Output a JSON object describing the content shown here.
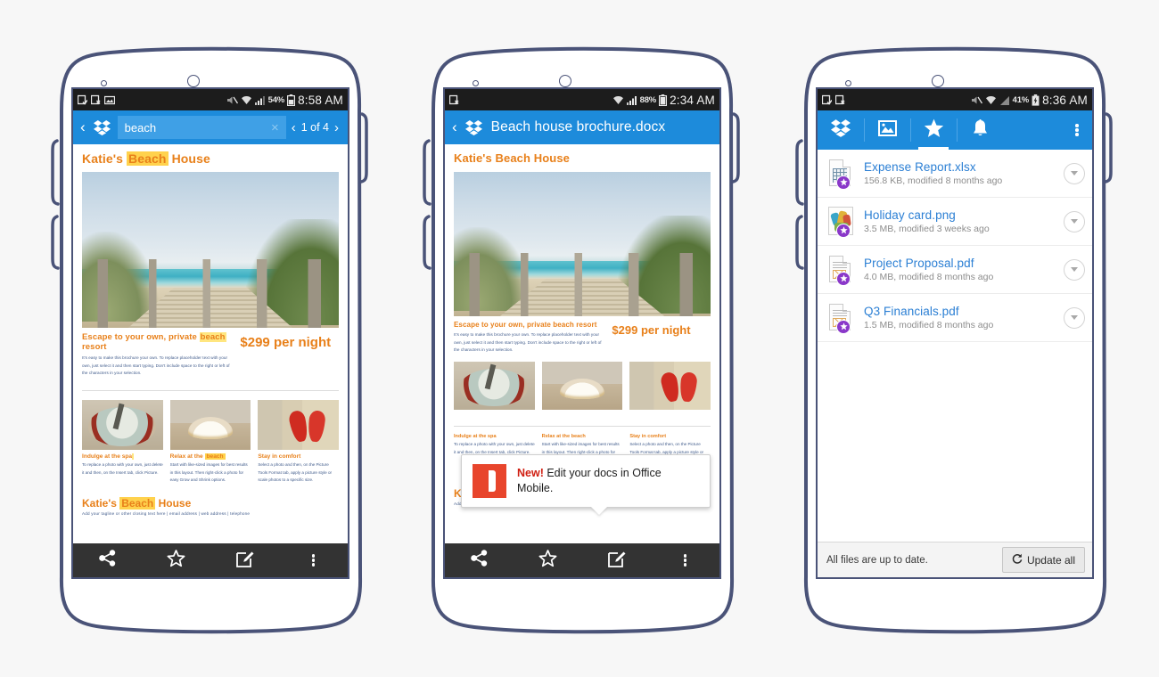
{
  "phones": [
    {
      "id": "phone-search-result",
      "statusbar": {
        "battery_pct": "54%",
        "time": "8:58 AM",
        "icons": [
          "download-complete-icon",
          "download-failed-icon",
          "screenshot-icon",
          "mute-icon",
          "wifi-icon",
          "signal-icon",
          "battery-icon"
        ]
      },
      "appbar": {
        "back_label": "‹",
        "logo": "dropbox-logo-icon",
        "search_value": "beach",
        "search_placeholder": "Search",
        "clear_label": "×",
        "prev_label": "‹",
        "pager_label": "1 of 4",
        "next_label": "›"
      },
      "document": {
        "title_pre": "Katie's ",
        "title_hl": "Beach",
        "title_post": " House",
        "sub_pre": "Escape to your own, private ",
        "sub_hl": "beach",
        "sub_post": " resort",
        "body": "It's easy to make this brochure your own. To replace placeholder text with your own, just select it and then start typing. Don't include space to the right or left of the characters in your selection.",
        "price": "$299 per night",
        "cards": [
          {
            "heading_pre": "Indulge at the spa",
            "heading_hl": "",
            "heading_post": "",
            "body": "To replace a photo with your own, just delete it and then, on the Insert tab, click Picture.",
            "image": "spa-bowl-photo"
          },
          {
            "heading_pre": "Relax at the ",
            "heading_hl": "beach",
            "heading_post": "",
            "body": "Start with like-sized images for best results in this layout. Then right-click a photo for easy Grow and Shrink options.",
            "image": "seashell-photo"
          },
          {
            "heading_pre": "Stay in comfort",
            "heading_hl": "",
            "heading_post": "",
            "body": "Select a photo and then, on the Picture Tools Format tab, apply a picture style or scale photos to a specific size.",
            "image": "flip-flops-photo"
          }
        ],
        "footer_pre": "Katie's ",
        "footer_hl": "Beach",
        "footer_post": " House",
        "footer_sub": "Add your tagline or other closing text here  |  email address  |  web address  |  telephone"
      },
      "bottombar": [
        "share-icon",
        "star-icon",
        "edit-icon",
        "overflow-menu-icon"
      ]
    },
    {
      "id": "phone-document-preview",
      "statusbar": {
        "battery_pct": "88%",
        "time": "2:34 AM",
        "icons": [
          "download-failed-icon",
          "wifi-icon",
          "signal-icon",
          "battery-icon"
        ]
      },
      "appbar": {
        "back_label": "‹",
        "logo": "dropbox-logo-icon",
        "doc_title": "Beach house brochure.docx"
      },
      "document": {
        "title_pre": "Katie's Beach House",
        "title_hl": "",
        "title_post": "",
        "sub_pre": "Escape to your own, private beach resort",
        "sub_hl": "",
        "sub_post": "",
        "body": "It's easy to make this brochure your own. To replace placeholder text with your own, just select it and then start typing. Don't include space to the right or left of the characters in your selection.",
        "price": "$299 per night",
        "cards": [
          {
            "heading_pre": "Indulge at the spa",
            "heading_hl": "",
            "heading_post": "",
            "body": "To replace a photo with your own, just delete it and then, on the Insert tab, click Picture.",
            "image": "spa-bowl-photo"
          },
          {
            "heading_pre": "Relax at the beach",
            "heading_hl": "",
            "heading_post": "",
            "body": "Start with like-sized images for best results in this layout. Then right-click a photo for easy Grow and Shrink options.",
            "image": "seashell-photo"
          },
          {
            "heading_pre": "Stay in comfort",
            "heading_hl": "",
            "heading_post": "",
            "body": "Select a photo and then, on the Picture Tools Format tab, apply a picture style or scale photos to a specific size.",
            "image": "flip-flops-photo"
          }
        ],
        "footer_pre": "Katie's Beach House",
        "footer_hl": "",
        "footer_post": "",
        "footer_sub": "Add your tagline or other closing text here  |  email address  |  web address  |  telephone"
      },
      "tooltip": {
        "icon": "office-logo-icon",
        "badge": "New!",
        "message": " Edit your docs in Office Mobile."
      },
      "bottombar": [
        "share-icon",
        "star-icon",
        "edit-icon",
        "overflow-menu-icon"
      ]
    },
    {
      "id": "phone-favorites-list",
      "statusbar": {
        "battery_pct": "41%",
        "time": "8:36 AM",
        "icons": [
          "download-complete-icon",
          "download-failed-icon",
          "mute-icon",
          "wifi-icon",
          "signal-icon",
          "battery-charging-icon"
        ]
      },
      "tabs": [
        {
          "name": "tab-files",
          "icon": "dropbox-logo-icon",
          "active": false
        },
        {
          "name": "tab-photos",
          "icon": "photos-icon",
          "active": false
        },
        {
          "name": "tab-favorites",
          "icon": "star-icon",
          "active": true
        },
        {
          "name": "tab-notifications",
          "icon": "bell-icon",
          "active": false
        }
      ],
      "overflow": "overflow-menu-icon",
      "files": [
        {
          "name": "Expense Report.xlsx",
          "meta": "156.8 KB, modified 8 months ago",
          "icon": "xlsx-file-icon",
          "favorite": true
        },
        {
          "name": "Holiday card.png",
          "meta": "3.5 MB, modified 3 weeks ago",
          "icon": "png-thumbnail-icon",
          "favorite": true
        },
        {
          "name": "Project Proposal.pdf",
          "meta": "4.0 MB, modified 8 months ago",
          "icon": "pdf-file-icon",
          "favorite": true
        },
        {
          "name": "Q3 Financials.pdf",
          "meta": "1.5 MB, modified 8 months ago",
          "icon": "pdf-file-icon",
          "favorite": true
        }
      ],
      "footer": {
        "message": "All files are up to date.",
        "button_label": "Update all",
        "button_icon": "refresh-icon"
      }
    }
  ],
  "colors": {
    "dropbox_blue": "#1d8bdb",
    "status_bar": "#1c1c1c",
    "toolbar_dark": "#333333",
    "brand_orange": "#e8801a",
    "highlight_yellow": "#ffd24d",
    "file_link_blue": "#2b7fd4",
    "favorite_purple": "#8a38c9",
    "office_red": "#e8452c",
    "frame_navy": "#4a5378"
  }
}
